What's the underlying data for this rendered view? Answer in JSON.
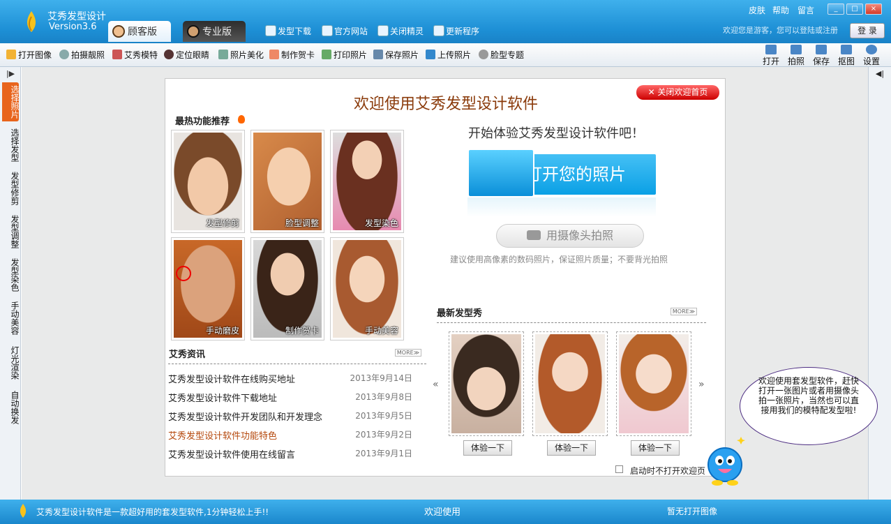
{
  "app": {
    "title": "艾秀发型设计",
    "version": "Version3.6"
  },
  "tabs": {
    "guest": "顾客版",
    "pro": "专业版"
  },
  "top_links": [
    "发型下载",
    "官方网站",
    "关闭精灵",
    "更新程序"
  ],
  "top_right": {
    "skin": "皮肤",
    "help": "帮助",
    "message": "留言",
    "welcome_guest": "欢迎您是游客，您可以登陆或注册",
    "login": "登 录"
  },
  "window_controls": {
    "minimize": "_",
    "maximize": "□",
    "close": "×"
  },
  "toolbar": [
    "打开图像",
    "拍摄靓照",
    "艾秀模特",
    "定位眼睛",
    "照片美化",
    "制作贺卡",
    "打印照片",
    "保存照片",
    "上传照片",
    "脸型专题"
  ],
  "toolbar_right": [
    "打开",
    "拍照",
    "保存",
    "抠图",
    "设置"
  ],
  "left_nav": {
    "collapse": "|▶",
    "items": [
      "选择照片",
      "选择发型",
      "发型修剪",
      "发型调整",
      "发型染色",
      "手动美容",
      "灯光渲染",
      "自动换发"
    ]
  },
  "right_nav": {
    "collapse": "◀|"
  },
  "welcome": {
    "title": "欢迎使用艾秀发型设计软件",
    "close_button": "✕ 关闭欢迎首页",
    "hot_title": "最热功能推荐",
    "hot_items": [
      "发型修剪",
      "脸型调整",
      "发型染色",
      "手动磨皮",
      "制作贺卡",
      "手动美容"
    ],
    "news_title": "艾秀资讯",
    "more": "MORE≫",
    "news": [
      {
        "title": "艾秀发型设计软件在线购买地址",
        "date": "2013年9月14日"
      },
      {
        "title": "艾秀发型设计软件下载地址",
        "date": "2013年9月8日"
      },
      {
        "title": "艾秀发型设计软件开发团队和开发理念",
        "date": "2013年9月5日"
      },
      {
        "title": "艾秀发型设计软件功能特色",
        "date": "2013年9月2日"
      },
      {
        "title": "艾秀发型设计软件使用在线留言",
        "date": "2013年9月1日"
      }
    ],
    "start_text": "开始体验艾秀发型设计软件吧！",
    "open_photo": "打开您的照片",
    "camera": "用摄像头拍照",
    "tip": "建议使用高像素的数码照片，保证照片质量；不要背光拍照",
    "newest_title": "最新发型秀",
    "try_label": "体验一下",
    "prev": "«",
    "next": "»",
    "no_show": "启动时不打开欢迎页"
  },
  "bubble": "欢迎使用套发型软件，赶快打开一张图片或者用摄像头拍一张照片，当然也可以直接用我们的模特配发型啦!",
  "status": {
    "left": "艾秀发型设计软件是一款超好用的套发型软件,1分钟轻松上手!!",
    "center": "欢迎使用",
    "right": "暂无打开图像"
  },
  "colors": {
    "titlebar": "#1d8fd5",
    "accent": "#e8641c",
    "welcome_title": "#8a3a0a",
    "close_red": "#dd1111"
  }
}
